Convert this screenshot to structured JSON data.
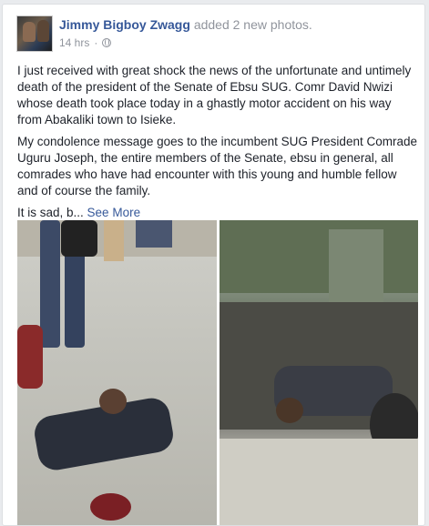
{
  "post": {
    "author": "Jimmy Bigboy Zwagg",
    "action": "added 2 new photos.",
    "timestamp": "14 hrs",
    "separator": "·",
    "privacy_icon": "globe-icon",
    "paragraphs": [
      "I just received with great shock the news of the unfortunate and untimely death of the president of the Senate of Ebsu SUG. Comr David Nwizi whose death took place today in a ghastly motor accident on his way from Abakaliki town to Isieke.",
      "My condolence message goes to the incumbent SUG President Comrade Uguru Joseph, the entire members of the Senate, ebsu in general, all comrades who have had encounter with this young and humble fellow and of course the family."
    ],
    "truncated_text": "It is sad, b...",
    "see_more": "See More"
  },
  "colors": {
    "link": "#365899",
    "meta": "#90949c",
    "text": "#1d2129",
    "background": "#e9ebee"
  }
}
